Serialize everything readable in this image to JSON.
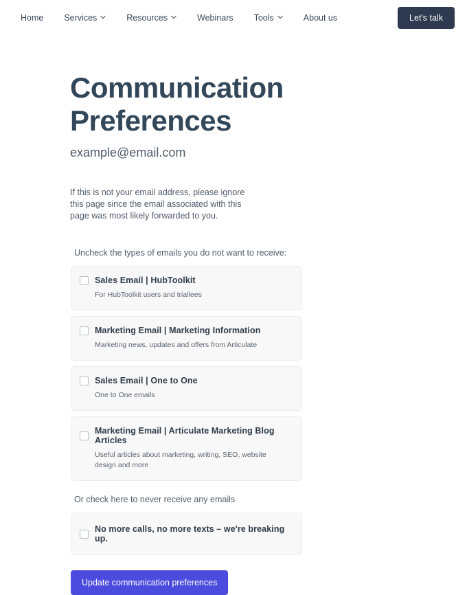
{
  "nav": {
    "items": [
      {
        "label": "Home",
        "has_dropdown": false
      },
      {
        "label": "Services",
        "has_dropdown": true
      },
      {
        "label": "Resources",
        "has_dropdown": true
      },
      {
        "label": "Webinars",
        "has_dropdown": false
      },
      {
        "label": "Tools",
        "has_dropdown": true
      },
      {
        "label": "About us",
        "has_dropdown": false
      }
    ],
    "cta_label": "Let's talk",
    "cta_color": "#2e3a4f"
  },
  "page": {
    "title": "Communication Preferences",
    "email": "example@email.com",
    "intro": "If this is not your email address, please ignore this page since the email associated with this page was most likely forwarded to you.",
    "uncheck_note": "Uncheck the types of emails you do not want to receive:",
    "never_note": "Or check here to never receive any emails",
    "submit_label": "Update communication preferences",
    "submit_color": "#4b4bdd"
  },
  "options": [
    {
      "title": "Sales  Email  |  HubToolkit",
      "description": "For HubToolkit users and triallees",
      "checked": false
    },
    {
      "title": "Marketing  Email  |  Marketing Information",
      "description": "Marketing news, updates and offers from Articulate",
      "checked": false
    },
    {
      "title": "Sales  Email  |  One to One",
      "description": "One to One emails",
      "checked": false
    },
    {
      "title": "Marketing  Email  |  Articulate Marketing Blog Articles",
      "description": "Useful articles about marketing, writing, SEO, website design and more",
      "checked": false
    }
  ],
  "unsubscribe_all": {
    "title": "No more calls, no more texts – we're breaking up.",
    "checked": false
  }
}
